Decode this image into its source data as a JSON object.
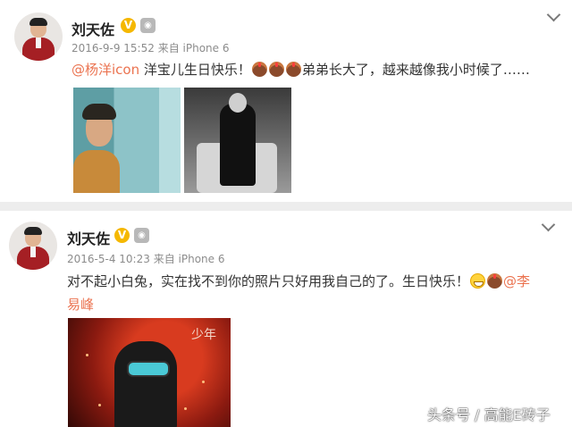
{
  "posts": [
    {
      "author": "刘天佐",
      "verified_badge": "V",
      "time": "2016-9-9 15:52",
      "source": "来自 iPhone 6",
      "mention": "@杨洋icon",
      "text_after_mention": " 洋宝儿生日快乐！",
      "text_tail": "弟弟长大了，越来越像我小时候了……",
      "emoji": [
        "cake-icon",
        "cake-icon",
        "cake-icon"
      ]
    },
    {
      "author": "刘天佐",
      "verified_badge": "V",
      "time": "2016-5-4 10:23",
      "source": "来自 iPhone 6",
      "text_line1": "对不起小白兔，实在找不到你的照片只好用我自己的了。生日快乐！",
      "mention_part1": "@李",
      "mention_part2": "易峰",
      "emoji": [
        "grin-icon",
        "cake-icon"
      ],
      "photo_title": "少年"
    }
  ],
  "watermark": "头条号 / 高能E砖子",
  "colors": {
    "mention": "#eb7350",
    "verified": "#f5b800",
    "divider": "#ededed",
    "meta": "#8c8c8c"
  }
}
